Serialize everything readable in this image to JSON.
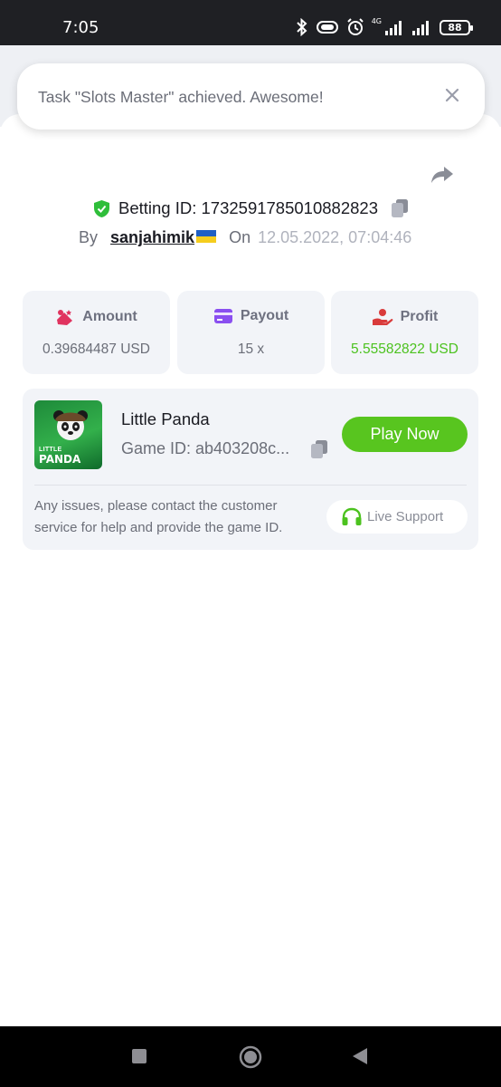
{
  "status_bar": {
    "time": "7:05",
    "network": "4G",
    "battery": "88"
  },
  "toast": {
    "message": "Task \"Slots Master\" achieved. Awesome!"
  },
  "bet": {
    "label": "Betting ID: 1732591785010882823",
    "by_label": "By",
    "username": "sanjahimik",
    "on_label": "On",
    "date": "12.05.2022, 07:04:46"
  },
  "stats": [
    {
      "title": "Amount",
      "value": "0.39684487 USD",
      "icon": "coins-icon"
    },
    {
      "title": "Payout",
      "value": "15 x",
      "icon": "wallet-card-icon"
    },
    {
      "title": "Profit",
      "value": "5.55582822 USD",
      "icon": "hand-coin-icon"
    }
  ],
  "game": {
    "title": "Little Panda",
    "id": "Game ID: ab403208c...",
    "thumb_line1": "LITTLE",
    "thumb_line2": "PANDA",
    "play_label": "Play Now"
  },
  "help": {
    "text": "Any issues, please contact the customer service for help and provide the game ID.",
    "support_label": "Live Support"
  },
  "colors": {
    "accent_green": "#58c51f",
    "profit_green": "#4cc21f",
    "card_bg": "#f2f4f8"
  }
}
